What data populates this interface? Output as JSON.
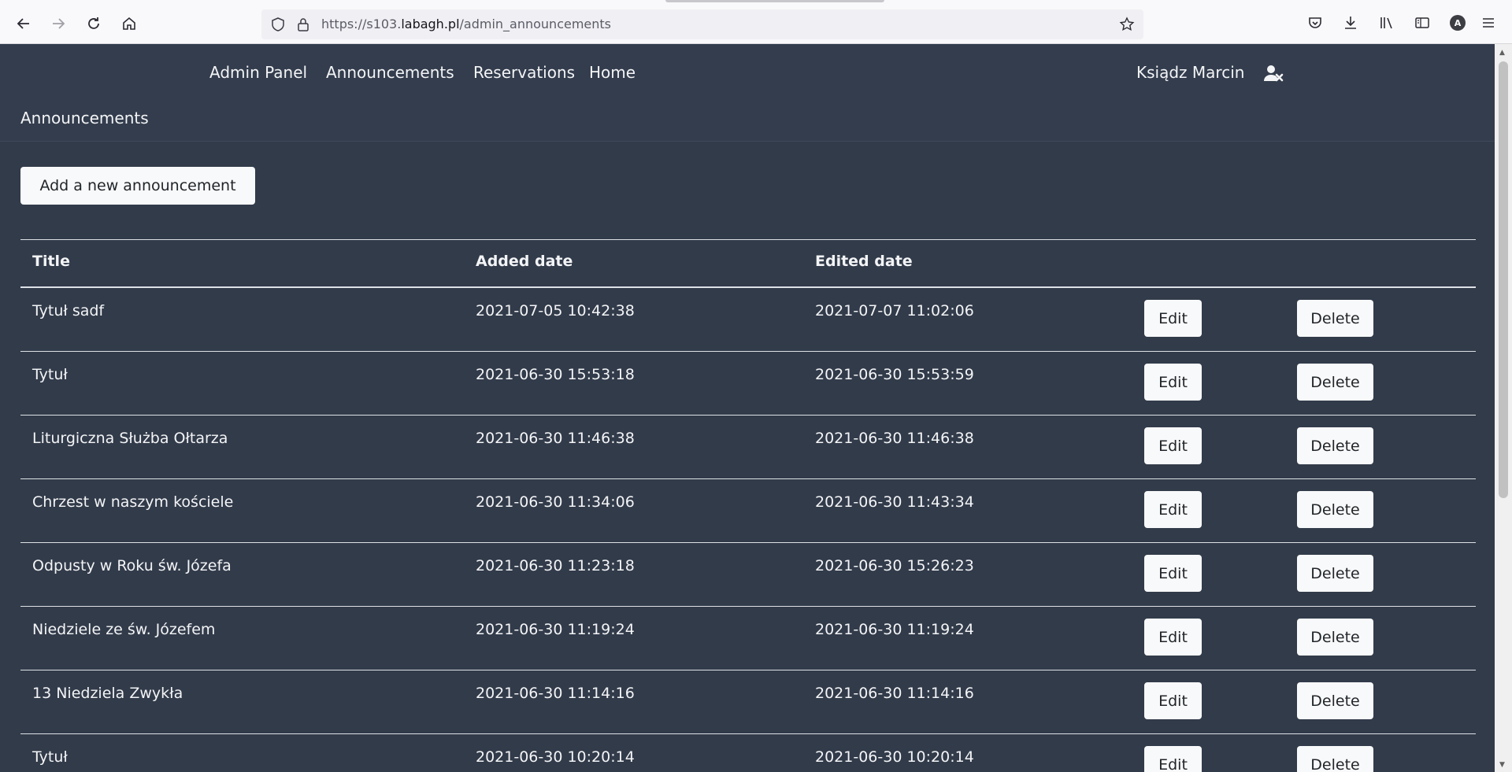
{
  "browser": {
    "url_prefix": "https://s103.",
    "url_host": "labagh.pl",
    "url_path": "/admin_announcements",
    "account_initial": "A"
  },
  "nav": {
    "links": [
      "Admin Panel",
      "Announcements",
      "Reservations",
      "Home"
    ],
    "user_name": "Ksiądz Marcin"
  },
  "section_title": "Announcements",
  "add_button": "Add a new announcement",
  "table": {
    "headers": [
      "Title",
      "Added date",
      "Edited date"
    ],
    "edit_label": "Edit",
    "delete_label": "Delete",
    "rows": [
      {
        "title": "Tytuł sadf",
        "added": "2021-07-05 10:42:38",
        "edited": "2021-07-07 11:02:06"
      },
      {
        "title": "Tytuł",
        "added": "2021-06-30 15:53:18",
        "edited": "2021-06-30 15:53:59"
      },
      {
        "title": "Liturgiczna Służba Ołtarza",
        "added": "2021-06-30 11:46:38",
        "edited": "2021-06-30 11:46:38"
      },
      {
        "title": "Chrzest w naszym kościele",
        "added": "2021-06-30 11:34:06",
        "edited": "2021-06-30 11:43:34"
      },
      {
        "title": "Odpusty w Roku św. Józefa",
        "added": "2021-06-30 11:23:18",
        "edited": "2021-06-30 15:26:23"
      },
      {
        "title": "Niedziele ze św. Józefem",
        "added": "2021-06-30 11:19:24",
        "edited": "2021-06-30 11:19:24"
      },
      {
        "title": "13 Niedziela Zwykła",
        "added": "2021-06-30 11:14:16",
        "edited": "2021-06-30 11:14:16"
      },
      {
        "title": "Tytuł",
        "added": "2021-06-30 10:20:14",
        "edited": "2021-06-30 10:20:14"
      }
    ]
  }
}
